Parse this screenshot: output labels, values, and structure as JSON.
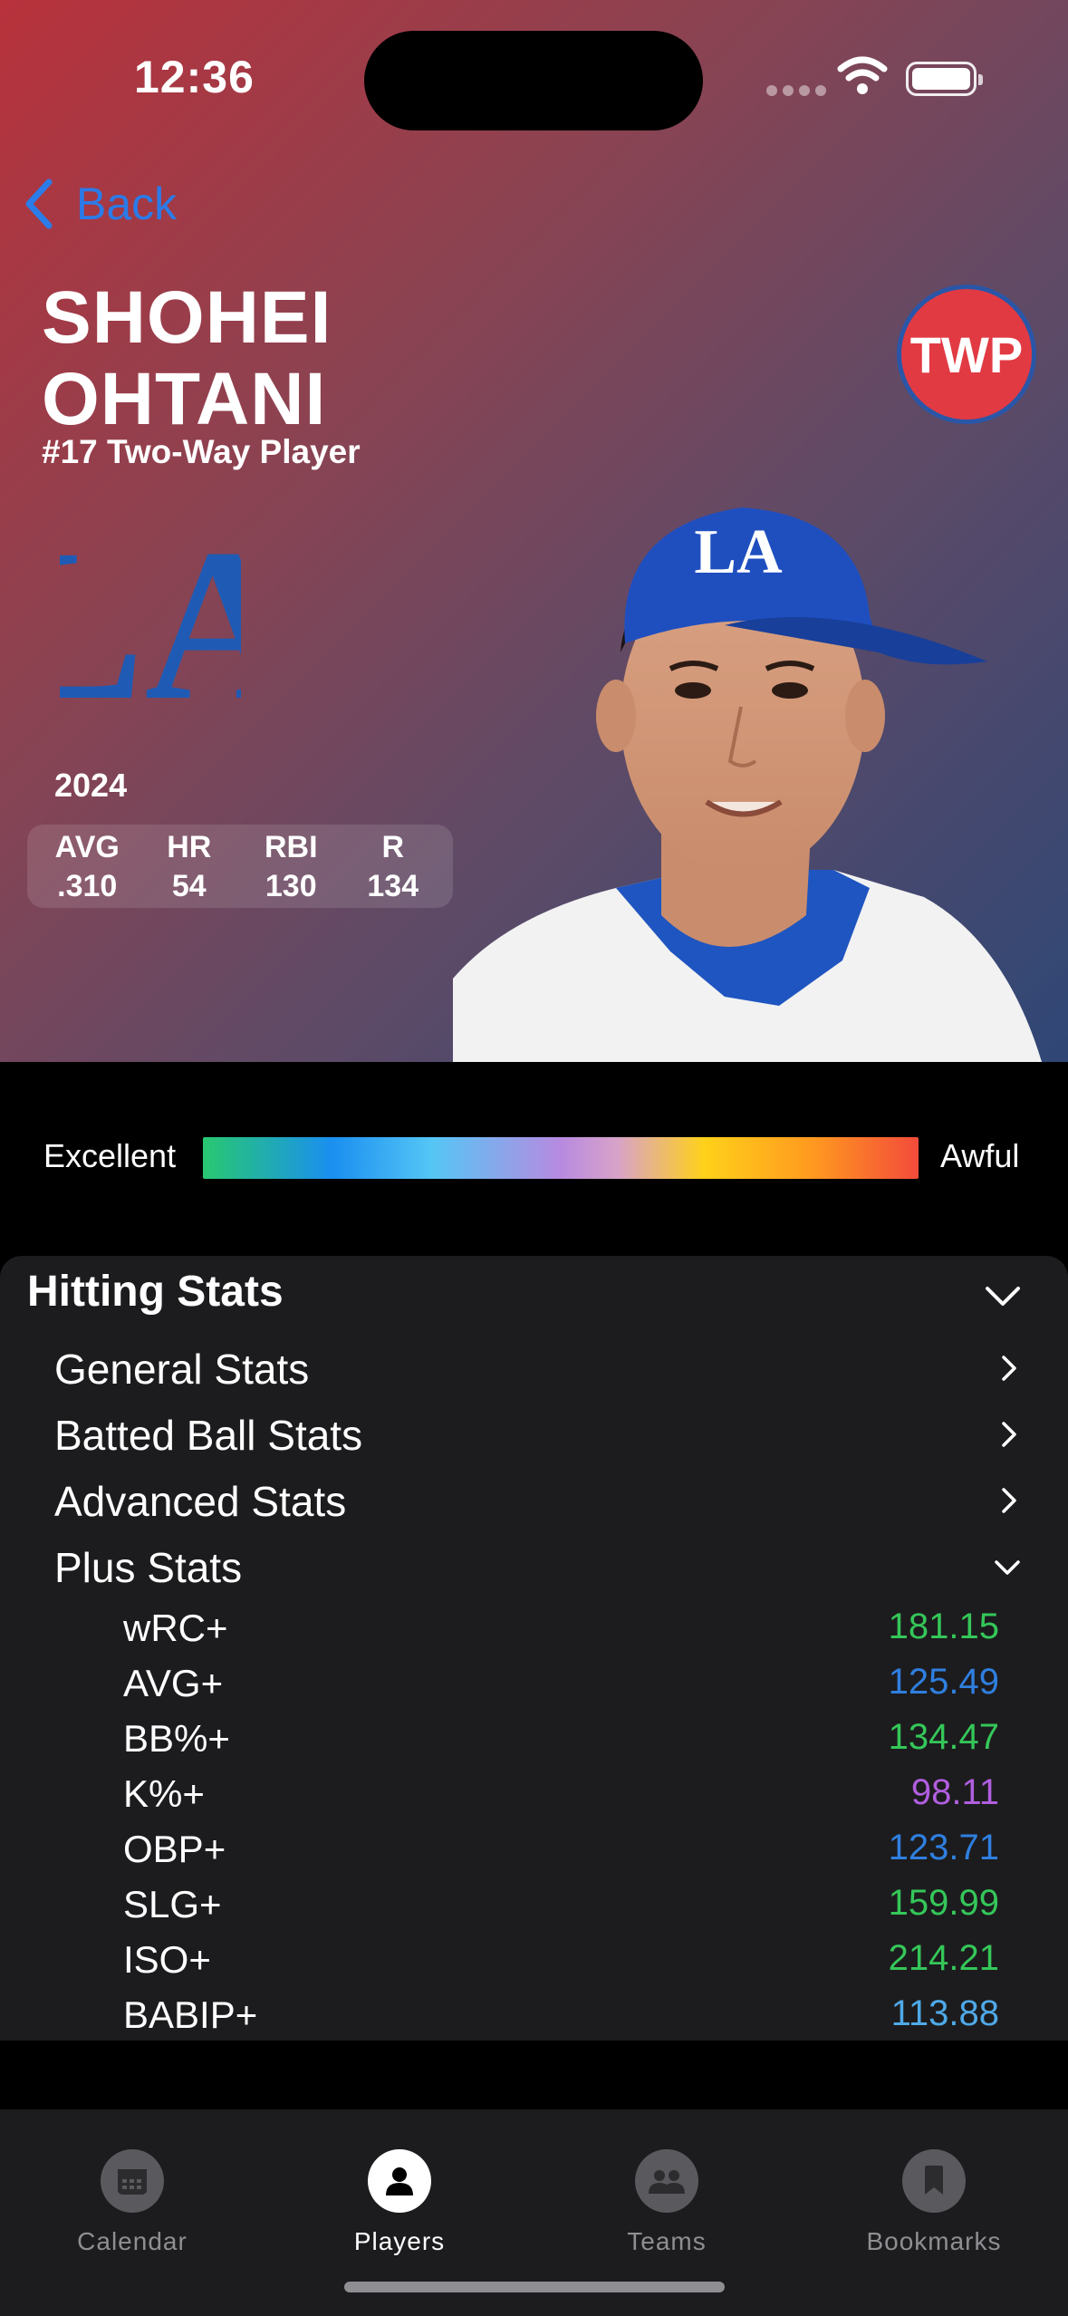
{
  "status_bar": {
    "time": "12:36"
  },
  "nav": {
    "back_label": "Back"
  },
  "player": {
    "first_name": "SHOHEI",
    "last_name": "OHTANI",
    "subtitle": "#17 Two-Way Player",
    "position_badge": "TWP",
    "team_logo_text": "LA"
  },
  "season": {
    "year": "2024",
    "stats": [
      {
        "label": "AVG",
        "value": ".310"
      },
      {
        "label": "HR",
        "value": "54"
      },
      {
        "label": "RBI",
        "value": "130"
      },
      {
        "label": "R",
        "value": "134"
      }
    ]
  },
  "scale": {
    "left_label": "Excellent",
    "right_label": "Awful"
  },
  "hitting": {
    "title": "Hitting Stats",
    "groups": [
      {
        "label": "General Stats"
      },
      {
        "label": "Batted Ball Stats"
      },
      {
        "label": "Advanced Stats"
      },
      {
        "label": "Plus Stats"
      }
    ],
    "plus_stats": [
      {
        "name": "wRC+",
        "value": "181.15",
        "color": "#35c759"
      },
      {
        "name": "AVG+",
        "value": "125.49",
        "color": "#2f7fe0"
      },
      {
        "name": "BB%+",
        "value": "134.47",
        "color": "#35c759"
      },
      {
        "name": "K%+",
        "value": "98.11",
        "color": "#b15ee0"
      },
      {
        "name": "OBP+",
        "value": "123.71",
        "color": "#2f7fe0"
      },
      {
        "name": "SLG+",
        "value": "159.99",
        "color": "#35c759"
      },
      {
        "name": "ISO+",
        "value": "214.21",
        "color": "#35c759"
      },
      {
        "name": "BABIP+",
        "value": "113.88",
        "color": "#4fa9e8"
      }
    ]
  },
  "tabs": [
    {
      "label": "Calendar",
      "icon": "calendar-icon"
    },
    {
      "label": "Players",
      "icon": "person-icon",
      "active": true
    },
    {
      "label": "Teams",
      "icon": "people-icon"
    },
    {
      "label": "Bookmarks",
      "icon": "bookmark-icon"
    }
  ],
  "colors": {
    "accent_blue": "#2b7be8",
    "badge_red": "#e13a43",
    "team_blue": "#1f5bb5"
  }
}
